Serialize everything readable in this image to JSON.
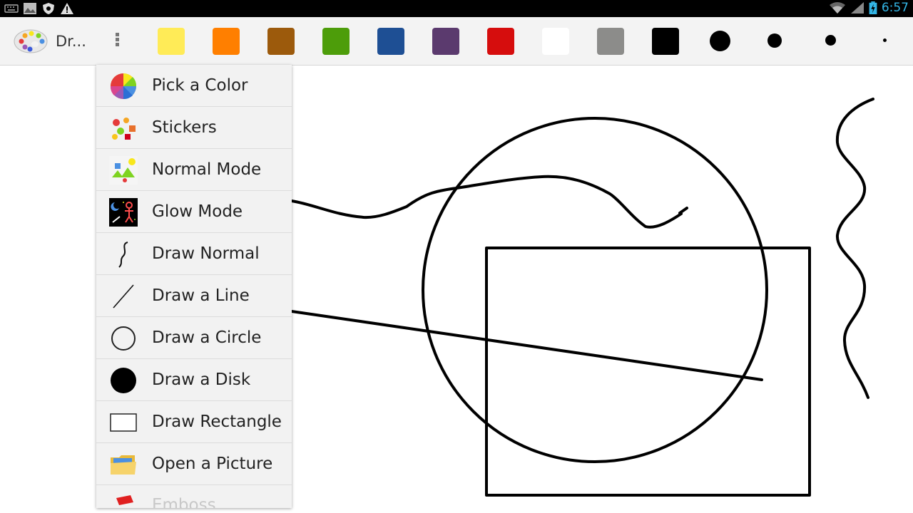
{
  "status_bar": {
    "time": "6:57",
    "left_icons": [
      "keyboard-icon",
      "image-icon",
      "shield-icon",
      "warning-icon"
    ],
    "right_icons": [
      "wifi-icon",
      "signal-icon",
      "battery-icon"
    ]
  },
  "action_bar": {
    "title": "Dr...",
    "app_icon": "palette-icon",
    "overflow_icon": "overflow-menu-icon",
    "colors": [
      {
        "name": "yellow",
        "hex": "#ffeb57"
      },
      {
        "name": "orange",
        "hex": "#ff7f00"
      },
      {
        "name": "brown",
        "hex": "#9c5a0c"
      },
      {
        "name": "green",
        "hex": "#4d9d0a"
      },
      {
        "name": "blue",
        "hex": "#1e4f94"
      },
      {
        "name": "purple",
        "hex": "#5b3a6e"
      },
      {
        "name": "red",
        "hex": "#d60d0d"
      },
      {
        "name": "white",
        "hex": "#ffffff"
      },
      {
        "name": "gray",
        "hex": "#8c8c8a"
      },
      {
        "name": "black",
        "hex": "#000000"
      }
    ],
    "brush_sizes": [
      "extra-large",
      "large",
      "medium",
      "small"
    ]
  },
  "menu": {
    "items": [
      {
        "label": "Pick a Color",
        "icon": "color-wheel-icon"
      },
      {
        "label": "Stickers",
        "icon": "stickers-icon"
      },
      {
        "label": "Normal Mode",
        "icon": "normal-mode-icon"
      },
      {
        "label": "Glow Mode",
        "icon": "glow-mode-icon"
      },
      {
        "label": "Draw Normal",
        "icon": "freehand-icon"
      },
      {
        "label": "Draw a Line",
        "icon": "line-icon"
      },
      {
        "label": "Draw a Circle",
        "icon": "circle-icon"
      },
      {
        "label": "Draw a Disk",
        "icon": "disk-icon"
      },
      {
        "label": "Draw Rectangle",
        "icon": "rectangle-icon"
      },
      {
        "label": "Open a Picture",
        "icon": "folder-icon"
      },
      {
        "label": "Emboss",
        "icon": "emboss-icon"
      }
    ]
  }
}
